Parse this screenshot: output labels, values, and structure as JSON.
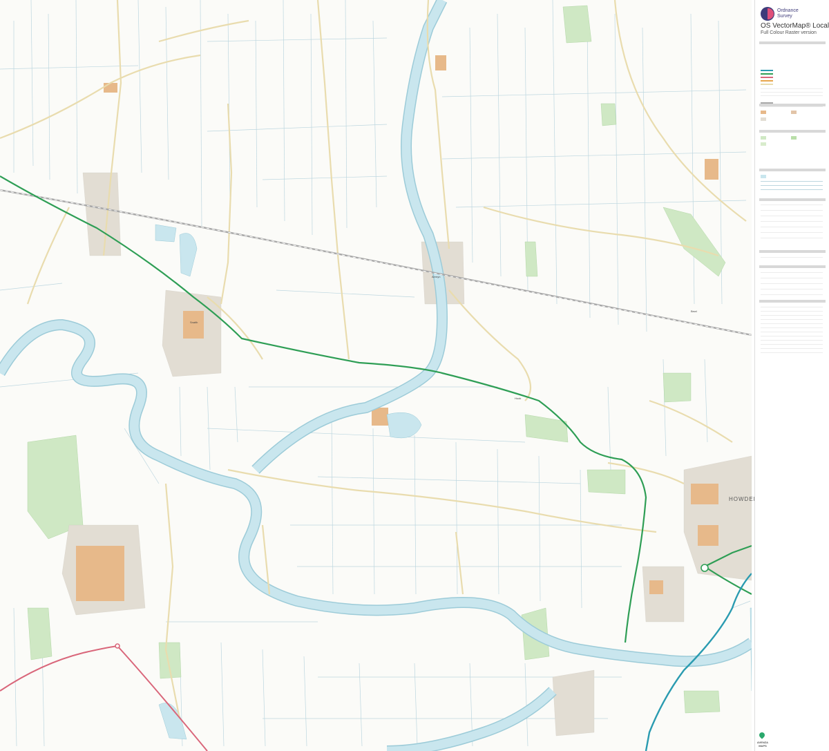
{
  "legend": {
    "brand_line1": "Ordnance",
    "brand_line2": "Survey",
    "title": "OS VectorMap® Local",
    "subtitle": "Full Colour Raster version",
    "publisher": "AVENZA MAPS"
  },
  "map": {
    "town_label": "HOWDEN"
  },
  "colors": {
    "primary_road": "#2e9e55",
    "motorway": "#2a9bb0",
    "a_road": "#d9667a",
    "railway": "#a8a8a8",
    "water": "#c9e6ee",
    "river_edge": "#9ccbd8",
    "woodland": "#cfe8c4",
    "building": "#e7b98a",
    "minor_road": "#e9dcae",
    "field_line": "#bcd6df",
    "urban": "#cfcabf"
  }
}
